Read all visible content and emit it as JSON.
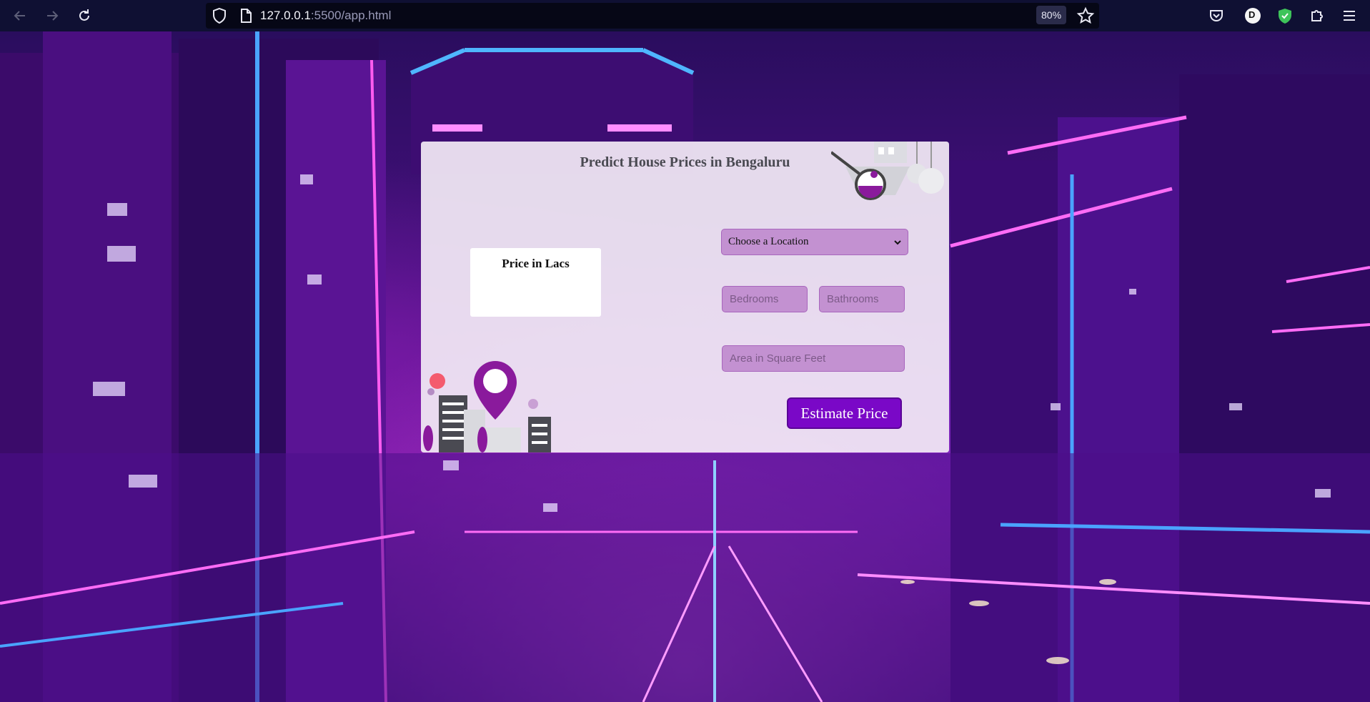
{
  "browser": {
    "url_host": "127.0.0.1",
    "url_path": ":5500/app.html",
    "zoom": "80%",
    "profile_initial": "D"
  },
  "page": {
    "title": "Predict House Prices in Bengaluru",
    "result_label": "Price in Lacs",
    "location_select": {
      "selected": "Choose a Location"
    },
    "bedrooms_placeholder": "Bedrooms",
    "bathrooms_placeholder": "Bathrooms",
    "area_placeholder": "Area in Square Feet",
    "estimate_label": "Estimate Price"
  },
  "colors": {
    "accent": "#7a08c7",
    "field_bg": "#c391d1",
    "card_bg": "#f2e9f5"
  }
}
